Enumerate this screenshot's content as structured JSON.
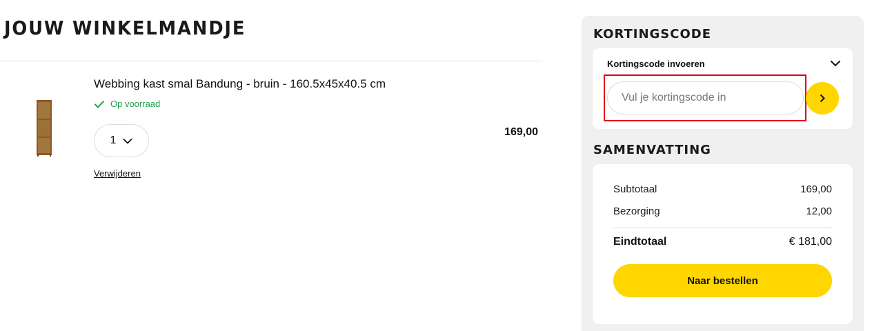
{
  "page": {
    "title": "JOUW WINKELMANDJE"
  },
  "cart": {
    "items": [
      {
        "name": "Webbing kast smal Bandung - bruin - 160.5x45x40.5 cm",
        "stock_status": "Op voorraad",
        "quantity": "1",
        "price": "169,00",
        "remove_label": "Verwijderen"
      }
    ]
  },
  "coupon": {
    "heading": "KORTINGSCODE",
    "toggle_label": "Kortingscode invoeren",
    "input_placeholder": "Vul je kortingscode in",
    "input_value": ""
  },
  "summary": {
    "heading": "SAMENVATTING",
    "rows": [
      {
        "label": "Subtotaal",
        "value": "169,00"
      },
      {
        "label": "Bezorging",
        "value": "12,00"
      }
    ],
    "total_label": "Eindtotaal",
    "total_value": "€ 181,00",
    "checkout_label": "Naar bestellen"
  },
  "colors": {
    "accent": "#ffd600",
    "stock_green": "#1aa14b",
    "highlight_red": "#e0001b",
    "panel_bg": "#f0f0f0"
  },
  "icons": {
    "stock": "check-icon",
    "quantity": "chevron-down-icon",
    "coupon_toggle": "chevron-down-icon",
    "coupon_submit": "chevron-right-icon"
  }
}
